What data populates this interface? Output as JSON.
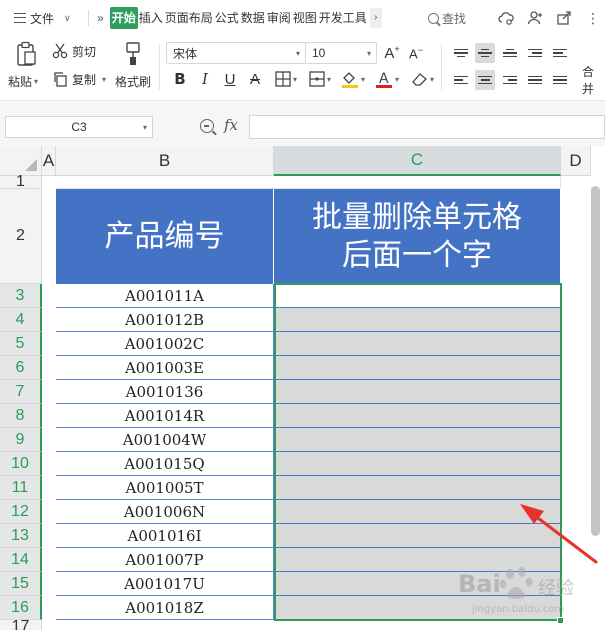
{
  "menu": {
    "file_label": "文件",
    "tabs": [
      "开始",
      "插入",
      "页面布局",
      "公式",
      "数据",
      "审阅",
      "视图",
      "开发工具"
    ],
    "active_tab": 0,
    "search_label": "查找"
  },
  "ribbon": {
    "paste_label": "粘贴",
    "cut_label": "剪切",
    "copy_label": "复制",
    "format_painter_label": "格式刷",
    "font_name": "宋体",
    "font_size": "10",
    "merge_label": "合并",
    "font_color": "#e02020",
    "fill_color": "#f5c518"
  },
  "formula_bar": {
    "name_box": "C3",
    "fx_label": "fx",
    "formula": ""
  },
  "sheet": {
    "columns": [
      "A",
      "B",
      "C",
      "D"
    ],
    "selected_column": "C",
    "row_numbers": [
      "1",
      "2",
      "3",
      "4",
      "5",
      "6",
      "7",
      "8",
      "9",
      "10",
      "11",
      "12",
      "13",
      "14",
      "15",
      "16",
      "17"
    ],
    "selected_rows": [
      "3",
      "4",
      "5",
      "6",
      "7",
      "8",
      "9",
      "10",
      "11",
      "12",
      "13",
      "14",
      "15",
      "16"
    ],
    "header_b": "产品编号",
    "header_c_line1": "批量删除单元格",
    "header_c_line2": "后面一个字",
    "codes": [
      "A001011A",
      "A001012B",
      "A001002C",
      "A001003E",
      "A0010136",
      "A001014R",
      "A001004W",
      "A001015Q",
      "A001005T",
      "A001006N",
      "A001016I",
      "A001007P",
      "A001017U",
      "A001018Z"
    ],
    "header_color": "#4472c4",
    "selection_color": "#2e9b58",
    "annotation_color": "#e8322d"
  },
  "watermark": {
    "brand": "Bai",
    "brand_cn": "经验",
    "url": "jingyan.baidu.com"
  }
}
